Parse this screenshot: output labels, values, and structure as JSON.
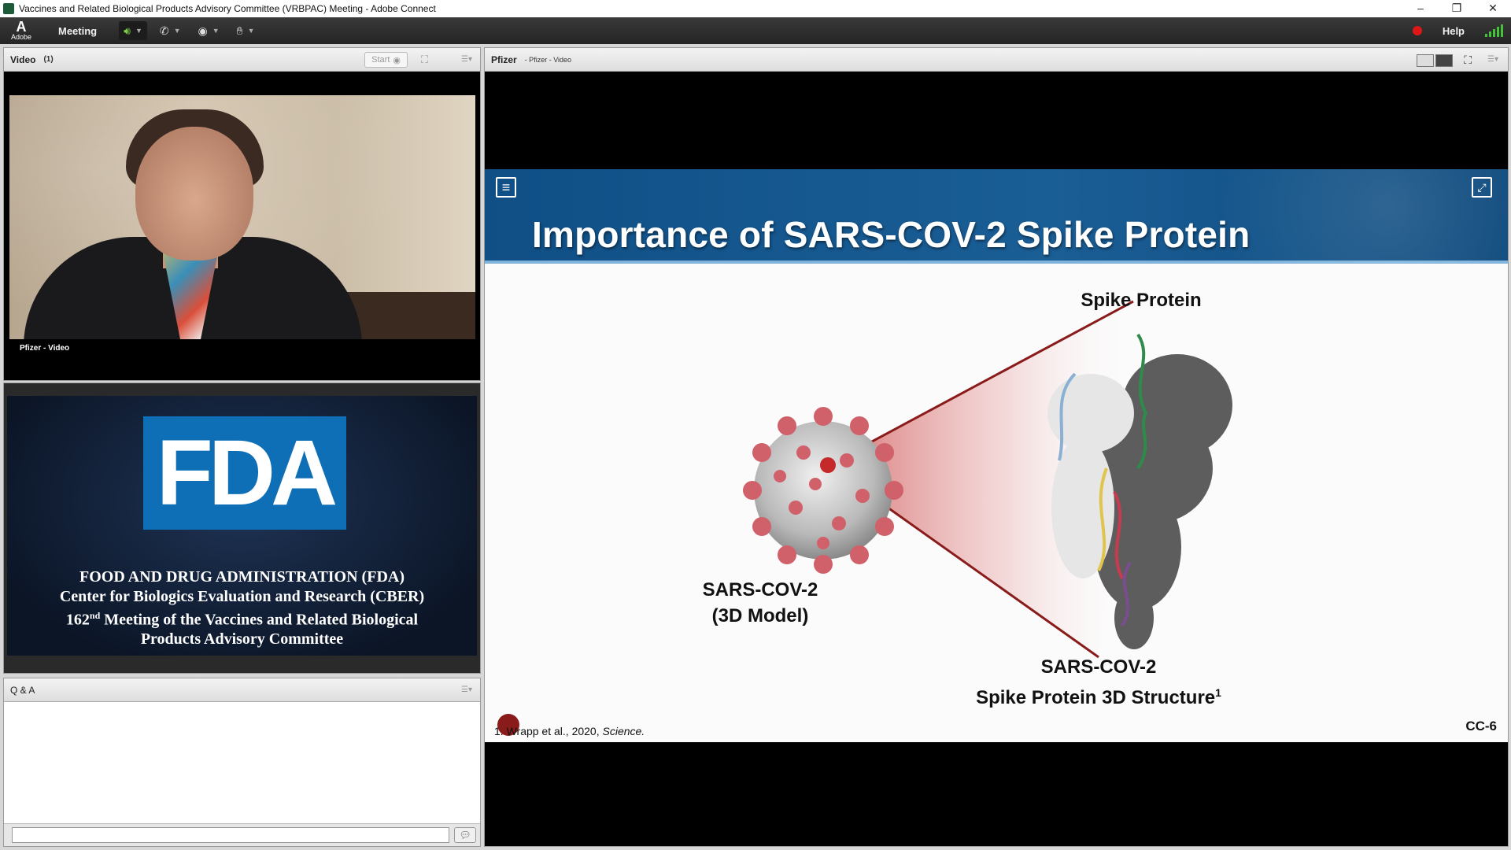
{
  "window": {
    "title": "Vaccines and Related Biological Products Advisory Committee (VRBPAC) Meeting - Adobe Connect",
    "controls": [
      "–",
      "❐",
      "✕"
    ]
  },
  "menubar": {
    "logo_letter": "A",
    "logo_text": "Adobe",
    "meeting_label": "Meeting",
    "help_label": "Help",
    "speaker_icon": "speaker-icon",
    "phone_icon": "phone-icon",
    "camera_icon": "webcam-icon",
    "raise_hand_icon": "raise-hand-icon"
  },
  "video_pod": {
    "title": "Video",
    "count": "(1)",
    "start_label": "Start",
    "feed_label": "Pfizer - Video"
  },
  "fda_pod": {
    "logo_text": "FDA",
    "line1": "FOOD AND DRUG ADMINISTRATION (FDA)",
    "line2": "Center for Biologics Evaluation and Research (CBER)",
    "line3_number": "162",
    "line3_sup": "nd",
    "line3_rest": " Meeting of the Vaccines and Related Biological",
    "line4": "Products Advisory Committee"
  },
  "qa_pod": {
    "title": "Q & A",
    "input_placeholder": ""
  },
  "share_pod": {
    "title": "Pfizer",
    "subtitle": "- Pfizer - Video"
  },
  "slide": {
    "title": "Importance of SARS-COV-2 Spike Protein",
    "spike_label": "Spike Protein",
    "virus_label_line1": "SARS-COV-2",
    "virus_label_line2": "(3D Model)",
    "structure_label_line1": "SARS-COV-2",
    "structure_label_line2": "Spike Protein 3D Structure",
    "structure_label_sup": "1",
    "citation_prefix": "1. Wrapp et al., 2020, ",
    "citation_journal": "Science.",
    "slide_number": "CC-6"
  },
  "colors": {
    "menubar_bg": "#2e2e2e",
    "slide_header_blue": "#1a5e96",
    "fda_blue": "#0e6fb7",
    "record_red": "#e01717",
    "beam_red": "#8a1b1b"
  }
}
